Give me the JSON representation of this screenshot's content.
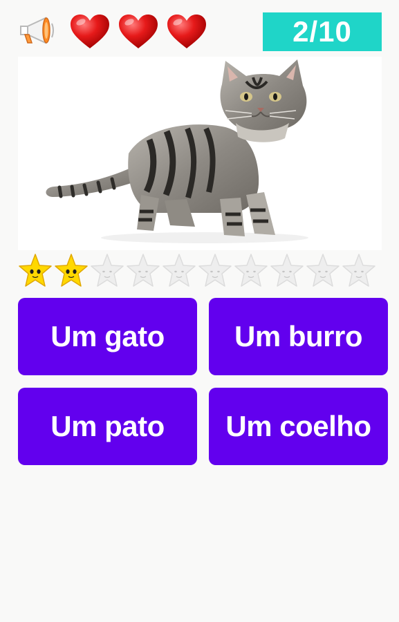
{
  "header": {
    "sound_icon": "megaphone-icon",
    "lives": [
      {
        "icon": "heart-icon",
        "color": "#e01414"
      },
      {
        "icon": "heart-icon",
        "color": "#e01414"
      },
      {
        "icon": "heart-icon",
        "color": "#e01414"
      }
    ],
    "progress": "2/10",
    "progress_color": "#1fd5c8"
  },
  "question": {
    "image": "tabby-cat-photo"
  },
  "stars": {
    "earned": 2,
    "total": 10,
    "earned_color": "#ffd800",
    "empty_color": "#eeeeee"
  },
  "answers": [
    {
      "label": "Um gato"
    },
    {
      "label": "Um burro"
    },
    {
      "label": "Um pato"
    },
    {
      "label": "Um coelho"
    }
  ],
  "button_color": "#6200ee"
}
